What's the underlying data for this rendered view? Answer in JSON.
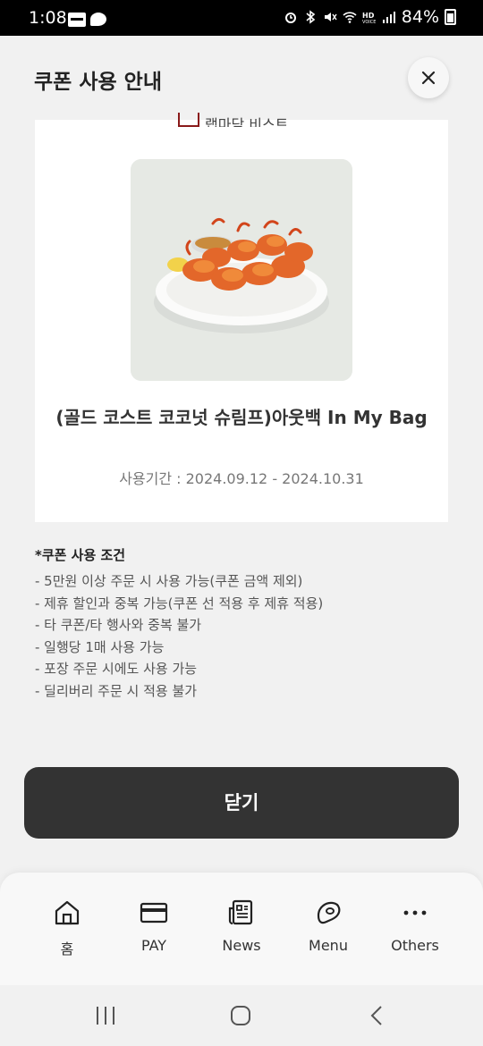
{
  "status_bar": {
    "time": "1:08",
    "battery": "84%"
  },
  "header": {
    "title": "쿠폰 사용 안내"
  },
  "card": {
    "brand_partial": "랩마담 비스트",
    "product_name": "(골드 코스트 코코넛 슈림프)아웃백 In My Bag",
    "period": "사용기간 : 2024.09.12 - 2024.10.31"
  },
  "conditions": {
    "heading": "*쿠폰 사용 조건",
    "items": [
      "- 5만원 이상 주문 시 사용 가능(쿠폰 금액 제외)",
      "- 제휴 할인과 중복 가능(쿠폰 선 적용 후 제휴 적용)",
      "- 타 쿠폰/타 행사와 중복 불가",
      "- 일행당 1매 사용 가능",
      "- 포장 주문 시에도 사용 가능",
      "- 딜리버리 주문 시 적용 불가"
    ]
  },
  "close_button": "닫기",
  "bottom_nav": [
    {
      "label": "홈",
      "icon": "home-icon"
    },
    {
      "label": "PAY",
      "icon": "card-icon"
    },
    {
      "label": "News",
      "icon": "news-icon"
    },
    {
      "label": "Menu",
      "icon": "steak-icon"
    },
    {
      "label": "Others",
      "icon": "more-icon"
    }
  ]
}
